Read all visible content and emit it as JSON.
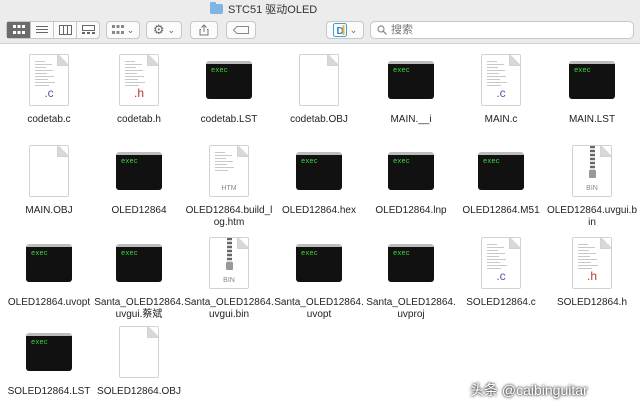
{
  "window": {
    "title": "STC51 驱动OLED"
  },
  "toolbar": {
    "search_placeholder": "搜索",
    "view_modes": [
      "icon-view",
      "list-view",
      "column-view",
      "gallery-view"
    ],
    "arrange_icon": "group-grid-icon",
    "action_icon": "gear-icon",
    "share_icon": "share-icon",
    "tag_icon": "tag-icon",
    "app_icon": "dashcode-app-icon"
  },
  "files": [
    {
      "name": "codetab.c",
      "icon": "c"
    },
    {
      "name": "codetab.h",
      "icon": "h"
    },
    {
      "name": "codetab.LST",
      "icon": "exec"
    },
    {
      "name": "codetab.OBJ",
      "icon": "blank"
    },
    {
      "name": "MAIN.__i",
      "icon": "exec"
    },
    {
      "name": "MAIN.c",
      "icon": "c"
    },
    {
      "name": "MAIN.LST",
      "icon": "exec"
    },
    {
      "name": "MAIN.OBJ",
      "icon": "blank"
    },
    {
      "name": "OLED12864",
      "icon": "exec"
    },
    {
      "name": "OLED12864.build_log.htm",
      "icon": "htm"
    },
    {
      "name": "OLED12864.hex",
      "icon": "exec"
    },
    {
      "name": "OLED12864.lnp",
      "icon": "exec"
    },
    {
      "name": "OLED12864.M51",
      "icon": "exec"
    },
    {
      "name": "OLED12864.uvgui.bin",
      "icon": "bin"
    },
    {
      "name": "OLED12864.uvopt",
      "icon": "exec"
    },
    {
      "name": "Santa_OLED12864.uvgui.蔡斌",
      "icon": "exec"
    },
    {
      "name": "Santa_OLED12864.uvgui.bin",
      "icon": "bin"
    },
    {
      "name": "Santa_OLED12864.uvopt",
      "icon": "exec"
    },
    {
      "name": "Santa_OLED12864.uvproj",
      "icon": "exec"
    },
    {
      "name": "SOLED12864.c",
      "icon": "c"
    },
    {
      "name": "SOLED12864.h",
      "icon": "h"
    },
    {
      "name": "SOLED12864.LST",
      "icon": "exec"
    },
    {
      "name": "SOLED12864.OBJ",
      "icon": "blank"
    }
  ],
  "icon_text": {
    "exec": "exec",
    "c": ".c",
    "h": ".h",
    "htm": "HTM",
    "bin": "BIN"
  },
  "watermark": "头条 @caibinguitar"
}
